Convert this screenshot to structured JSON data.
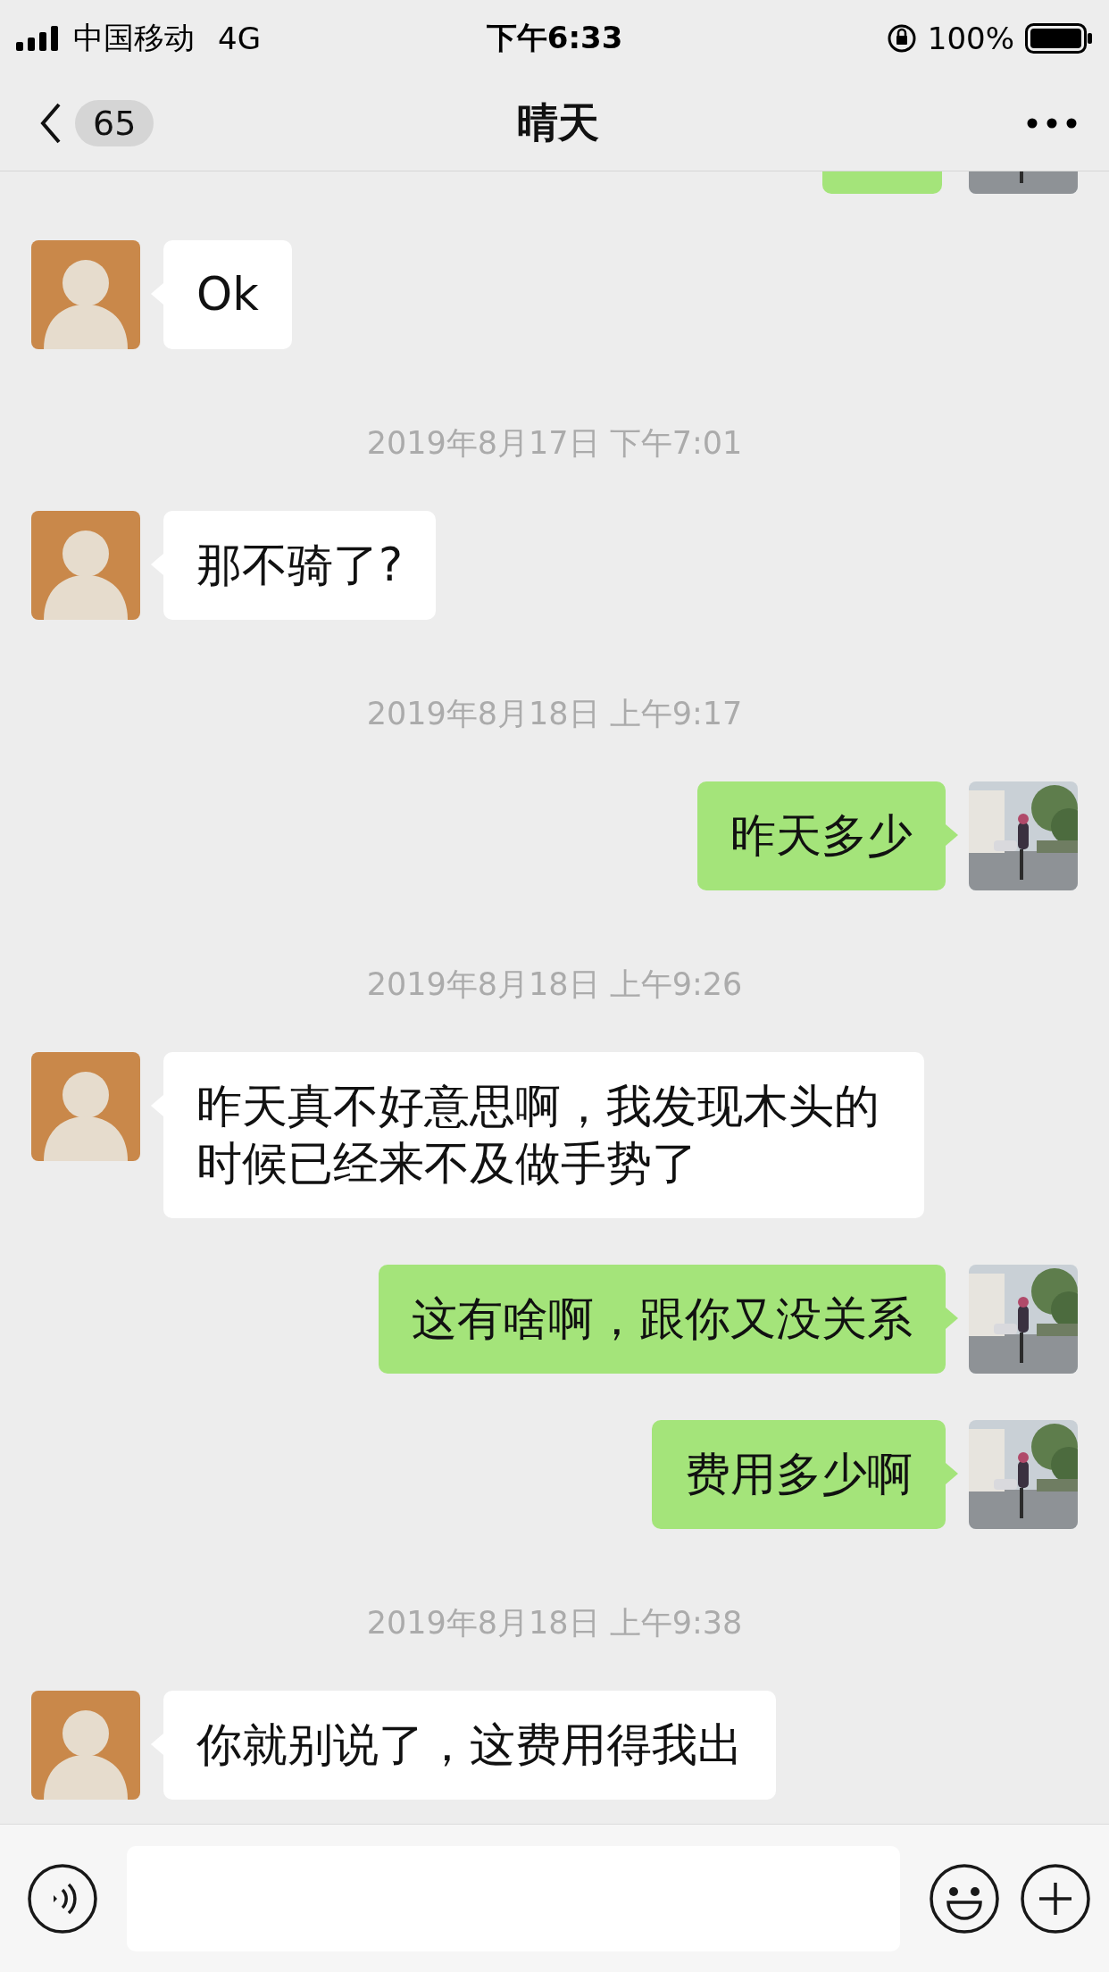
{
  "status_bar": {
    "carrier": "中国移动",
    "network": "4G",
    "time": "下午6:33",
    "battery": "100%"
  },
  "nav": {
    "back_count": "65",
    "title": "晴天"
  },
  "messages": [
    {
      "kind": "cut-off",
      "incoming": false
    },
    {
      "kind": "text",
      "incoming": true,
      "text": "Ok"
    },
    {
      "kind": "time",
      "text": "2019年8月17日 下午7:01"
    },
    {
      "kind": "text",
      "incoming": true,
      "text": "那不骑了?"
    },
    {
      "kind": "time",
      "text": "2019年8月18日 上午9:17"
    },
    {
      "kind": "text",
      "incoming": false,
      "text": "昨天多少"
    },
    {
      "kind": "time",
      "text": "2019年8月18日 上午9:26"
    },
    {
      "kind": "text",
      "incoming": true,
      "text": "昨天真不好意思啊，我发现木头的时候已经来不及做手势了"
    },
    {
      "kind": "text",
      "incoming": false,
      "text": "这有啥啊，跟你又没关系"
    },
    {
      "kind": "text",
      "incoming": false,
      "text": "费用多少啊"
    },
    {
      "kind": "time",
      "text": "2019年8月18日 上午9:38"
    },
    {
      "kind": "text",
      "incoming": true,
      "text": "你就别说了，这费用得我出"
    }
  ]
}
